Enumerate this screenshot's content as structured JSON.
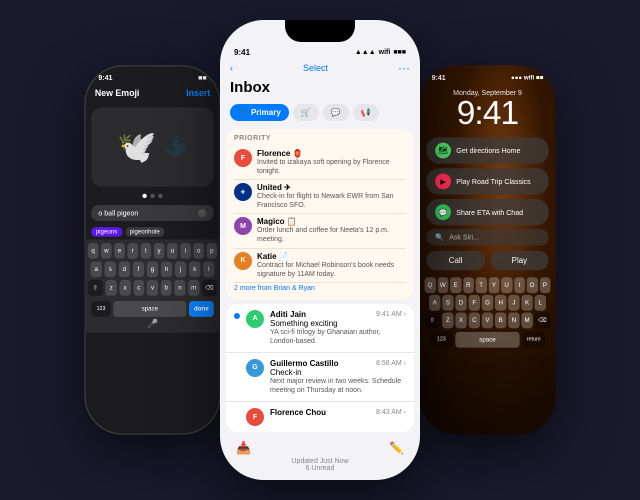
{
  "left_phone": {
    "status": {
      "time": "9:41",
      "battery": "■■"
    },
    "header": {
      "title": "New Emoji",
      "insert_label": "Insert"
    },
    "emojis": [
      "🕊️",
      "🌑"
    ],
    "search": {
      "query": "o ball pigeon",
      "clear_label": "×"
    },
    "suggestions": [
      "pigeons",
      "pigeonhole"
    ],
    "keyboard": {
      "row1": [
        "q",
        "w",
        "e",
        "r",
        "t",
        "y",
        "u",
        "i",
        "o",
        "p"
      ],
      "row2": [
        "a",
        "s",
        "d",
        "f",
        "g",
        "h",
        "j",
        "k",
        "l"
      ],
      "row3": [
        "z",
        "x",
        "c",
        "v",
        "b",
        "n",
        "m"
      ],
      "space_label": "space",
      "done_label": "done"
    }
  },
  "center_phone": {
    "status": {
      "time": "9:41",
      "signal": "●●●",
      "wifi": "wifi",
      "battery": "■■■"
    },
    "nav": {
      "back_label": "< ",
      "select_label": "Select",
      "dots_label": "···"
    },
    "title": "Inbox",
    "tabs": [
      {
        "label": "Primary",
        "icon": "👤",
        "active": true
      },
      {
        "label": "",
        "icon": "🛒",
        "active": false
      },
      {
        "label": "",
        "icon": "💬",
        "active": false
      },
      {
        "label": "",
        "icon": "📢",
        "active": false
      }
    ],
    "priority": {
      "label": "PRIORITY",
      "items": [
        {
          "sender": "Florence",
          "preview": "🏮 Invited to izakaya soft opening by Florence tonight.",
          "color": "#e74c3c",
          "initials": "F"
        },
        {
          "sender": "United",
          "preview": "✈ Check-in for flight to Newark EWR from San Francisco SFO.",
          "color": "#003087",
          "initials": "U"
        },
        {
          "sender": "Magico",
          "preview": "📋 Order lunch and coffee for Neeta's 12 p.m. meeting.",
          "color": "#8e44ad",
          "initials": "M"
        },
        {
          "sender": "Katie",
          "preview": "📄 Contract for Michael Robinson's book needs signature by 11AM today.",
          "color": "#e67e22",
          "initials": "K"
        }
      ],
      "more_label": "2 more from Brian & Ryan"
    },
    "mail_list": [
      {
        "sender": "Aditi Jain",
        "subject": "Something exciting",
        "preview": "YA sci-fi trilogy by Ghanaian author, London-based.",
        "time": "9:41 AM",
        "color": "#2ecc71",
        "initials": "A"
      },
      {
        "sender": "Guillermo Castillo",
        "subject": "Check-in",
        "preview": "Next major review in two weeks. Schedule meeting on Thursday at noon.",
        "time": "8:58 AM",
        "color": "#3498db",
        "initials": "G"
      },
      {
        "sender": "Florence Chou",
        "subject": "",
        "preview": "",
        "time": "8:43 AM",
        "color": "#e74c3c",
        "initials": "F"
      }
    ],
    "bottom_status": "Updated Just Now\n6 Unread"
  },
  "right_phone": {
    "status": {
      "time_display": "9:41",
      "signal": "●●●",
      "battery": "■■"
    },
    "date": "Monday, September 9",
    "time": "9:41",
    "suggestions": [
      {
        "icon": "🗺",
        "icon_bg": "#4cd964",
        "text": "Get directions Home"
      },
      {
        "icon": "▶",
        "icon_bg": "#ff2d55",
        "text": "Play Road Trip Classics"
      },
      {
        "icon": "💬",
        "icon_bg": "#34c759",
        "text": "Share ETA with Chad"
      }
    ],
    "siri_placeholder": "Ask Siri...",
    "call_label": "Call",
    "play_label": "Play",
    "keyboard": {
      "row1": [
        "Q",
        "W",
        "E",
        "R",
        "T",
        "Y",
        "U",
        "I",
        "O",
        "P"
      ],
      "row2": [
        "A",
        "S",
        "D",
        "F",
        "G",
        "H",
        "J",
        "K",
        "L"
      ],
      "row3": [
        "Z",
        "X",
        "C",
        "V",
        "B",
        "N",
        "M"
      ],
      "num_label": "123",
      "space_label": "space"
    }
  }
}
